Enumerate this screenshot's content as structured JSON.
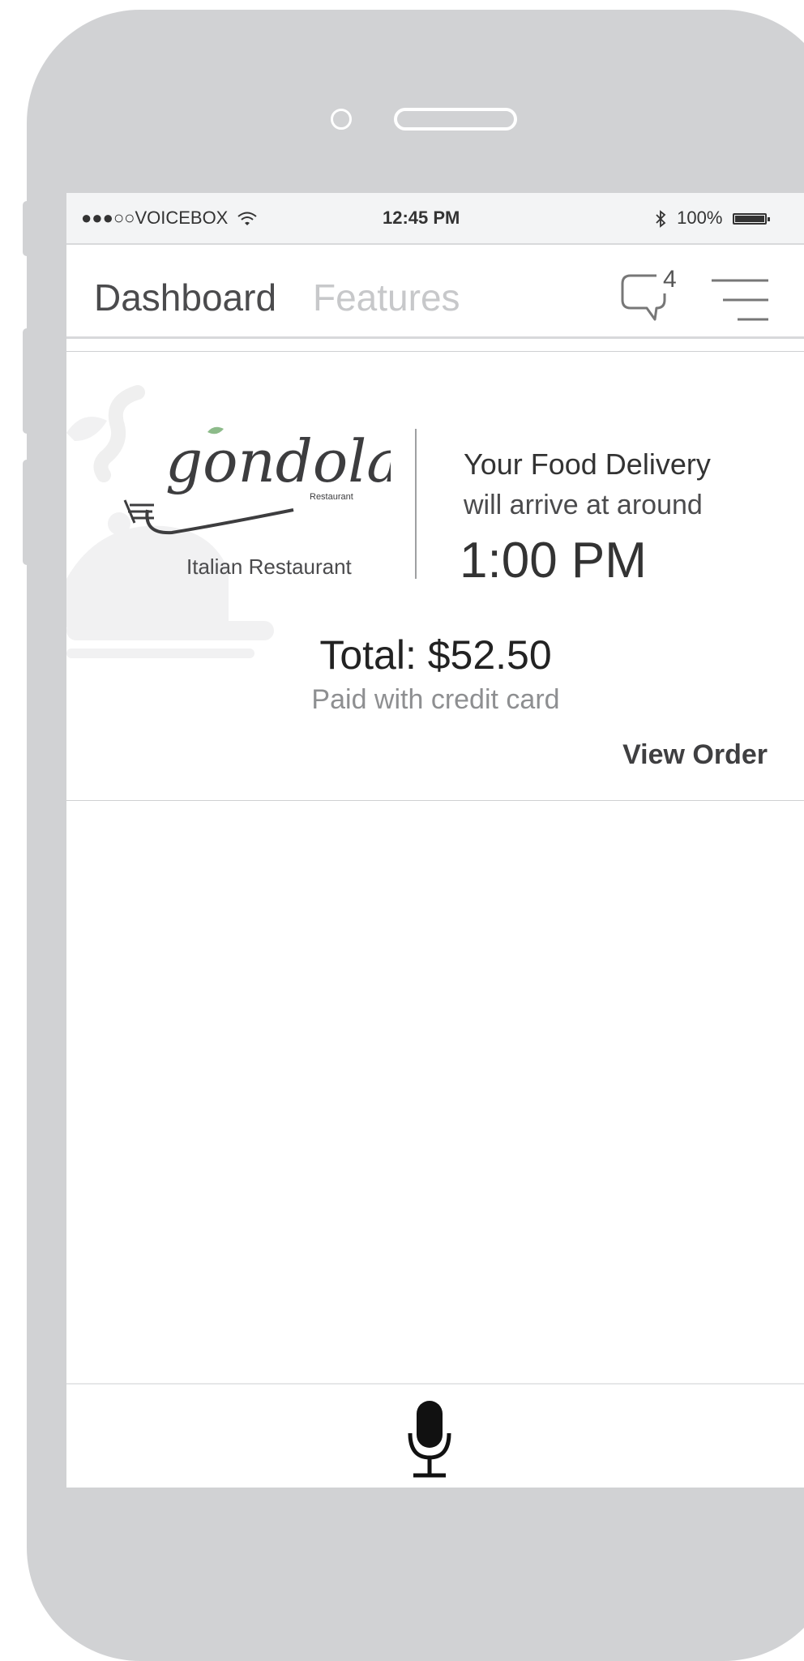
{
  "status_bar": {
    "carrier": "●●●○○VOICEBOX",
    "time": "12:45 PM",
    "battery": "100%"
  },
  "nav": {
    "tabs": [
      {
        "label": "Dashboard",
        "active": true
      },
      {
        "label": "Features",
        "active": false
      }
    ],
    "chat_badge_count": "4"
  },
  "order_card": {
    "restaurant_logo_text": "gondola",
    "restaurant_logo_subtext": "Restaurant",
    "restaurant_type": "Italian Restaurant",
    "eta_title": "Your Food Delivery",
    "eta_subtitle": "will arrive at around",
    "eta_time": "1:00 PM",
    "total": "Total: $52.50",
    "payment_note": "Paid with credit card",
    "view_order_label": "View Order"
  },
  "icons": {
    "chat": "chat-bubble-icon",
    "menu": "hamburger-menu-icon",
    "mic": "microphone-icon",
    "wifi": "wifi-icon",
    "bluetooth": "bluetooth-icon"
  },
  "colors": {
    "phone_body": "#d1d2d4",
    "active_tab": "#4b4b4d",
    "inactive_tab": "#c7c8ca"
  }
}
